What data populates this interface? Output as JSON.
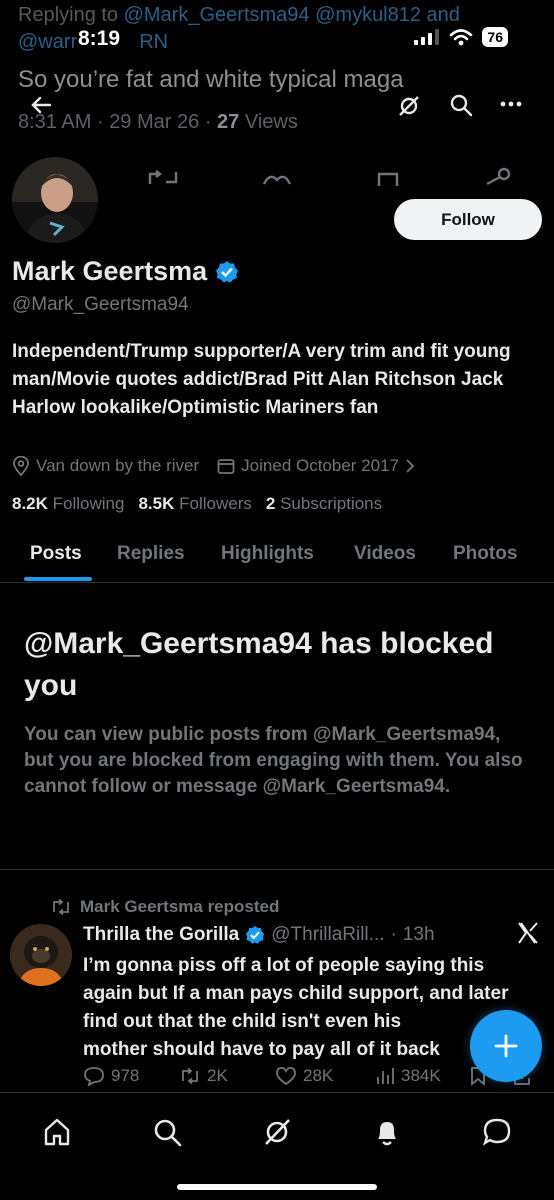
{
  "status_bar": {
    "time": "8:19",
    "battery": "76"
  },
  "background_tweet": {
    "replying_prefix": "Replying to",
    "mentions": "@Mark_Geertsma94 @mykul812 and",
    "mentions_line2": "@warr",
    "mentions_line2_tail": "RN",
    "text": "So you’re fat and white typical maga",
    "time": "8:31 AM",
    "sep1": "·",
    "date": "29 Mar 26",
    "sep2": "·",
    "views_count": "27",
    "views_label": "Views"
  },
  "profile": {
    "name": "Mark Geertsma",
    "handle": "@Mark_Geertsma94",
    "follow_label": "Follow",
    "bio": "Independent/Trump supporter/A very trim and fit young man/Movie quotes addict/Brad Pitt Alan Ritchson Jack Harlow lookalike/Optimistic Mariners fan",
    "location": "Van down by the river",
    "joined": "Joined October 2017",
    "following_count": "8.2K",
    "following_label": "Following",
    "followers_count": "8.5K",
    "followers_label": "Followers",
    "subscriptions_count": "2",
    "subscriptions_label": "Subscriptions",
    "verified_color": "#1d9bf0"
  },
  "tabs": [
    "Posts",
    "Replies",
    "Highlights",
    "Videos",
    "Photos"
  ],
  "blocked": {
    "title": "@Mark_Geertsma94 has blocked you",
    "description": "You can view public posts from @Mark_Geertsma94, but you are blocked from engaging with them. You also cannot follow or message @Mark_Geertsma94."
  },
  "tweet": {
    "repost_label": "Mark Geertsma reposted",
    "author_name": "Thrilla the Gorilla",
    "author_handle": "@ThrillaRill...",
    "sep": "·",
    "age": "13h",
    "text": "I’m gonna piss off a lot of people saying this again but If a man pays child support, and later find out that the child isn't even his",
    "text_tail": "mother should have to pay all of it back",
    "replies": "978",
    "reposts": "2K",
    "likes": "28K",
    "views": "384K"
  },
  "colors": {
    "accent": "#1d9bf0",
    "background": "#000000",
    "muted": "#71767b"
  }
}
